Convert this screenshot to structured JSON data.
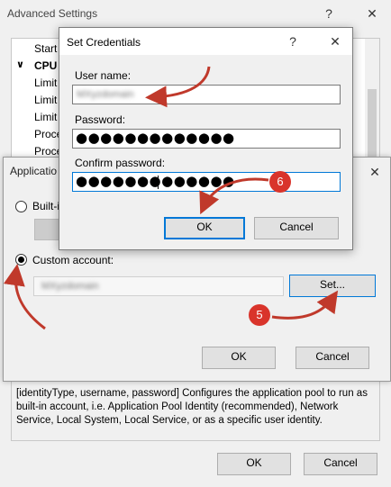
{
  "advanced_settings": {
    "title": "Advanced Settings",
    "help": "?",
    "close": "✕",
    "tree_items": [
      {
        "label": "Start",
        "bold": false
      },
      {
        "label": "CPU",
        "bold": true
      },
      {
        "label": "Limit",
        "bold": false
      },
      {
        "label": "Limit",
        "bold": false
      },
      {
        "label": "Limit",
        "bold": false
      },
      {
        "label": "Proce",
        "bold": false
      },
      {
        "label": "Proce",
        "bold": false
      }
    ],
    "tree_expand": "∨",
    "description": "[identityType, username, password] Configures the application pool to run as built-in account, i.e. Application Pool Identity (recommended), Network Service, Local System, Local Service, or as a specific user identity.",
    "ok_label": "OK",
    "cancel_label": "Cancel"
  },
  "app_pool_identity": {
    "title": "Applicatio",
    "close": "✕",
    "builtin_label": "Built-i",
    "custom_label": "Custom account:",
    "custom_value": "MXyzdomain",
    "set_label": "Set...",
    "ok_label": "OK",
    "cancel_label": "Cancel"
  },
  "set_credentials": {
    "title": "Set Credentials",
    "help": "?",
    "close": "✕",
    "username_label": "User name:",
    "username_value": "MXyzdomain",
    "password_label": "Password:",
    "password_value": "●●●●●●●●●●●●●",
    "confirm_label": "Confirm password:",
    "confirm_value": "●●●●●●●●●●●●●",
    "ok_label": "OK",
    "cancel_label": "Cancel"
  },
  "annotations": {
    "step5": "5",
    "step6": "6",
    "arrow_color": "#c0392b",
    "badge_color": "#d9342b"
  }
}
